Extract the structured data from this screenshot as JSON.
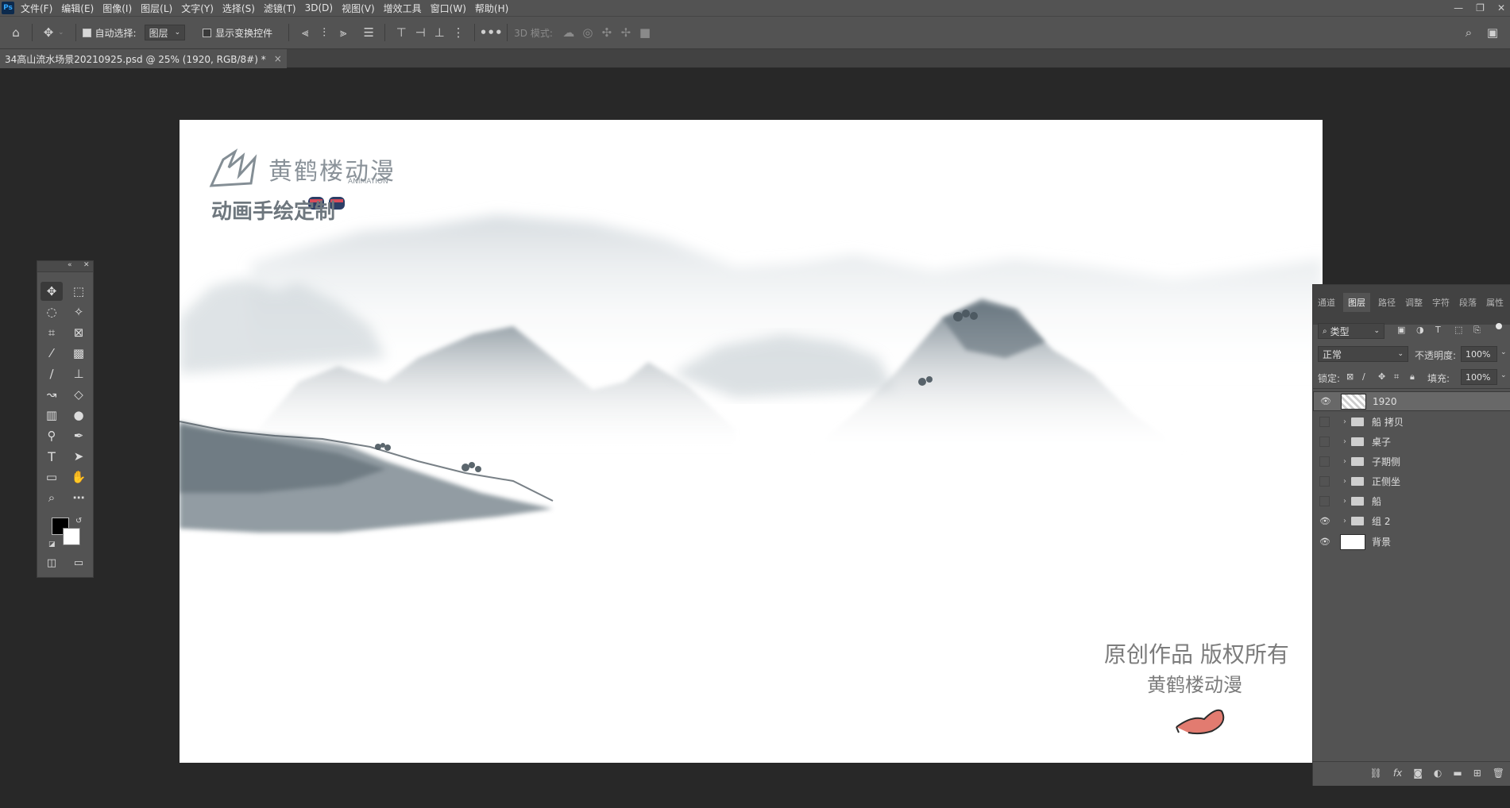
{
  "app": {
    "logo": "Ps"
  },
  "menu": [
    "文件(F)",
    "编辑(E)",
    "图像(I)",
    "图层(L)",
    "文字(Y)",
    "选择(S)",
    "滤镜(T)",
    "3D(D)",
    "视图(V)",
    "增效工具",
    "窗口(W)",
    "帮助(H)"
  ],
  "window_controls": {
    "minimize": "—",
    "restore": "❐",
    "close": "✕"
  },
  "options": {
    "auto_select_label": "自动选择:",
    "auto_select_checked": true,
    "auto_select_target": "图层",
    "show_transform_label": "显示变换控件",
    "show_transform_checked": false,
    "more": "•••",
    "mode_3d_label": "3D 模式:"
  },
  "document": {
    "tab_title": "34高山流水场景20210925.psd @ 25% (1920, RGB/8#) *",
    "close": "×"
  },
  "canvas": {
    "logo_text": "黄鹤楼动漫",
    "logo_sub": "ANIMATION",
    "slogan": "动画手绘定制",
    "copyright": "原创作品 版权所有",
    "studio": "黄鹤楼动漫"
  },
  "layers_panel": {
    "tabs": [
      "通道",
      "图层",
      "路径",
      "调整",
      "字符",
      "段落",
      "属性"
    ],
    "active_tab": "图层",
    "filter_label": "类型",
    "blend_mode": "正常",
    "opacity_label": "不透明度:",
    "opacity": "100%",
    "lock_label": "锁定:",
    "fill_label": "填充:",
    "fill": "100%",
    "layers": [
      {
        "name": "1920",
        "visible": true,
        "type": "smart",
        "selected": true
      },
      {
        "name": "船 拷贝",
        "visible": false,
        "type": "group"
      },
      {
        "name": "桌子",
        "visible": false,
        "type": "group"
      },
      {
        "name": "子期侧",
        "visible": false,
        "type": "group"
      },
      {
        "name": "正侧坐",
        "visible": false,
        "type": "group"
      },
      {
        "name": "船",
        "visible": false,
        "type": "group"
      },
      {
        "name": "组 2",
        "visible": true,
        "type": "group"
      },
      {
        "name": "背景",
        "visible": true,
        "type": "background"
      }
    ]
  },
  "colors": {
    "ui_bg": "#282828",
    "panel": "#535353",
    "accent": "#31a8ff",
    "foreground": "#000000",
    "background": "#ffffff"
  }
}
